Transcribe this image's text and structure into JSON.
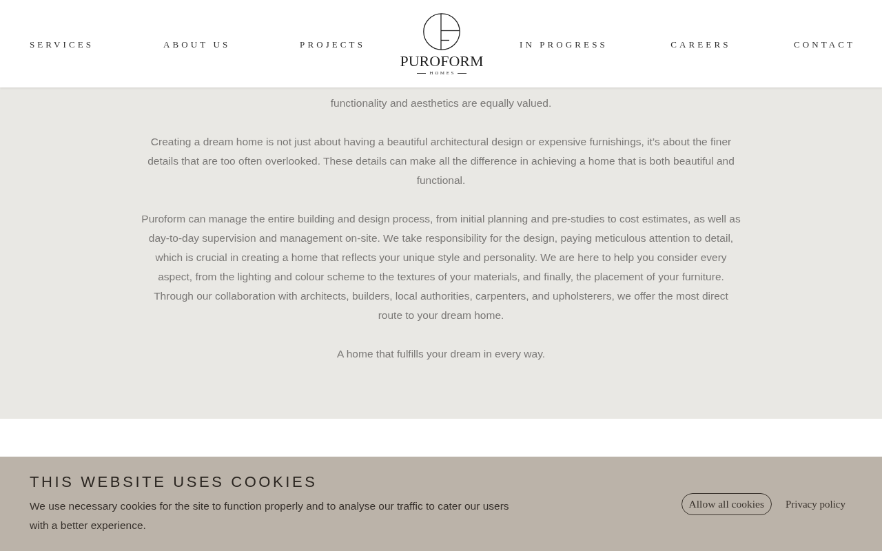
{
  "header": {
    "nav_left": [
      {
        "label": "SERVICES"
      },
      {
        "label": "ABOUT US"
      },
      {
        "label": "PROJECTS"
      }
    ],
    "logo": {
      "name": "PUROFORM",
      "tagline": "HOMES"
    },
    "nav_right": [
      {
        "label": "IN PROGRESS"
      },
      {
        "label": "CAREERS"
      },
      {
        "label": "CONTACT"
      }
    ]
  },
  "intro": {
    "paragraphs": [
      "functionality and aesthetics are equally valued.",
      "Creating a dream home is not just about having a beautiful architectural design or expensive furnishings, it’s about the finer details that are too often overlooked. These details can make all the difference in achieving a home that is both beautiful and functional.",
      "Puroform can manage the entire building and design process, from initial planning and pre-studies to cost estimates, as well as day-to-day supervision and management on-site. We take responsibility for the design, paying meticulous attention to detail, which is crucial in creating a home that reflects your unique style and personality. We are here to help you consider every aspect, from the lighting and colour scheme to the textures of your materials, and finally, the placement of your furniture. Through our collaboration with architects, builders, local authorities, carpenters, and upholsterers, we offer the most direct route to your dream home.",
      "A home that fulfills your dream in every way."
    ]
  },
  "cookie_banner": {
    "title": "THIS WEBSITE USES COOKIES",
    "text": "We use necessary cookies for the site to function properly and to analyse our traffic to cater our users with a better experience.",
    "buttons": [
      {
        "label": "Allow all cookies",
        "kind": "outlined"
      },
      {
        "label": "Privacy policy",
        "kind": "link"
      }
    ]
  }
}
